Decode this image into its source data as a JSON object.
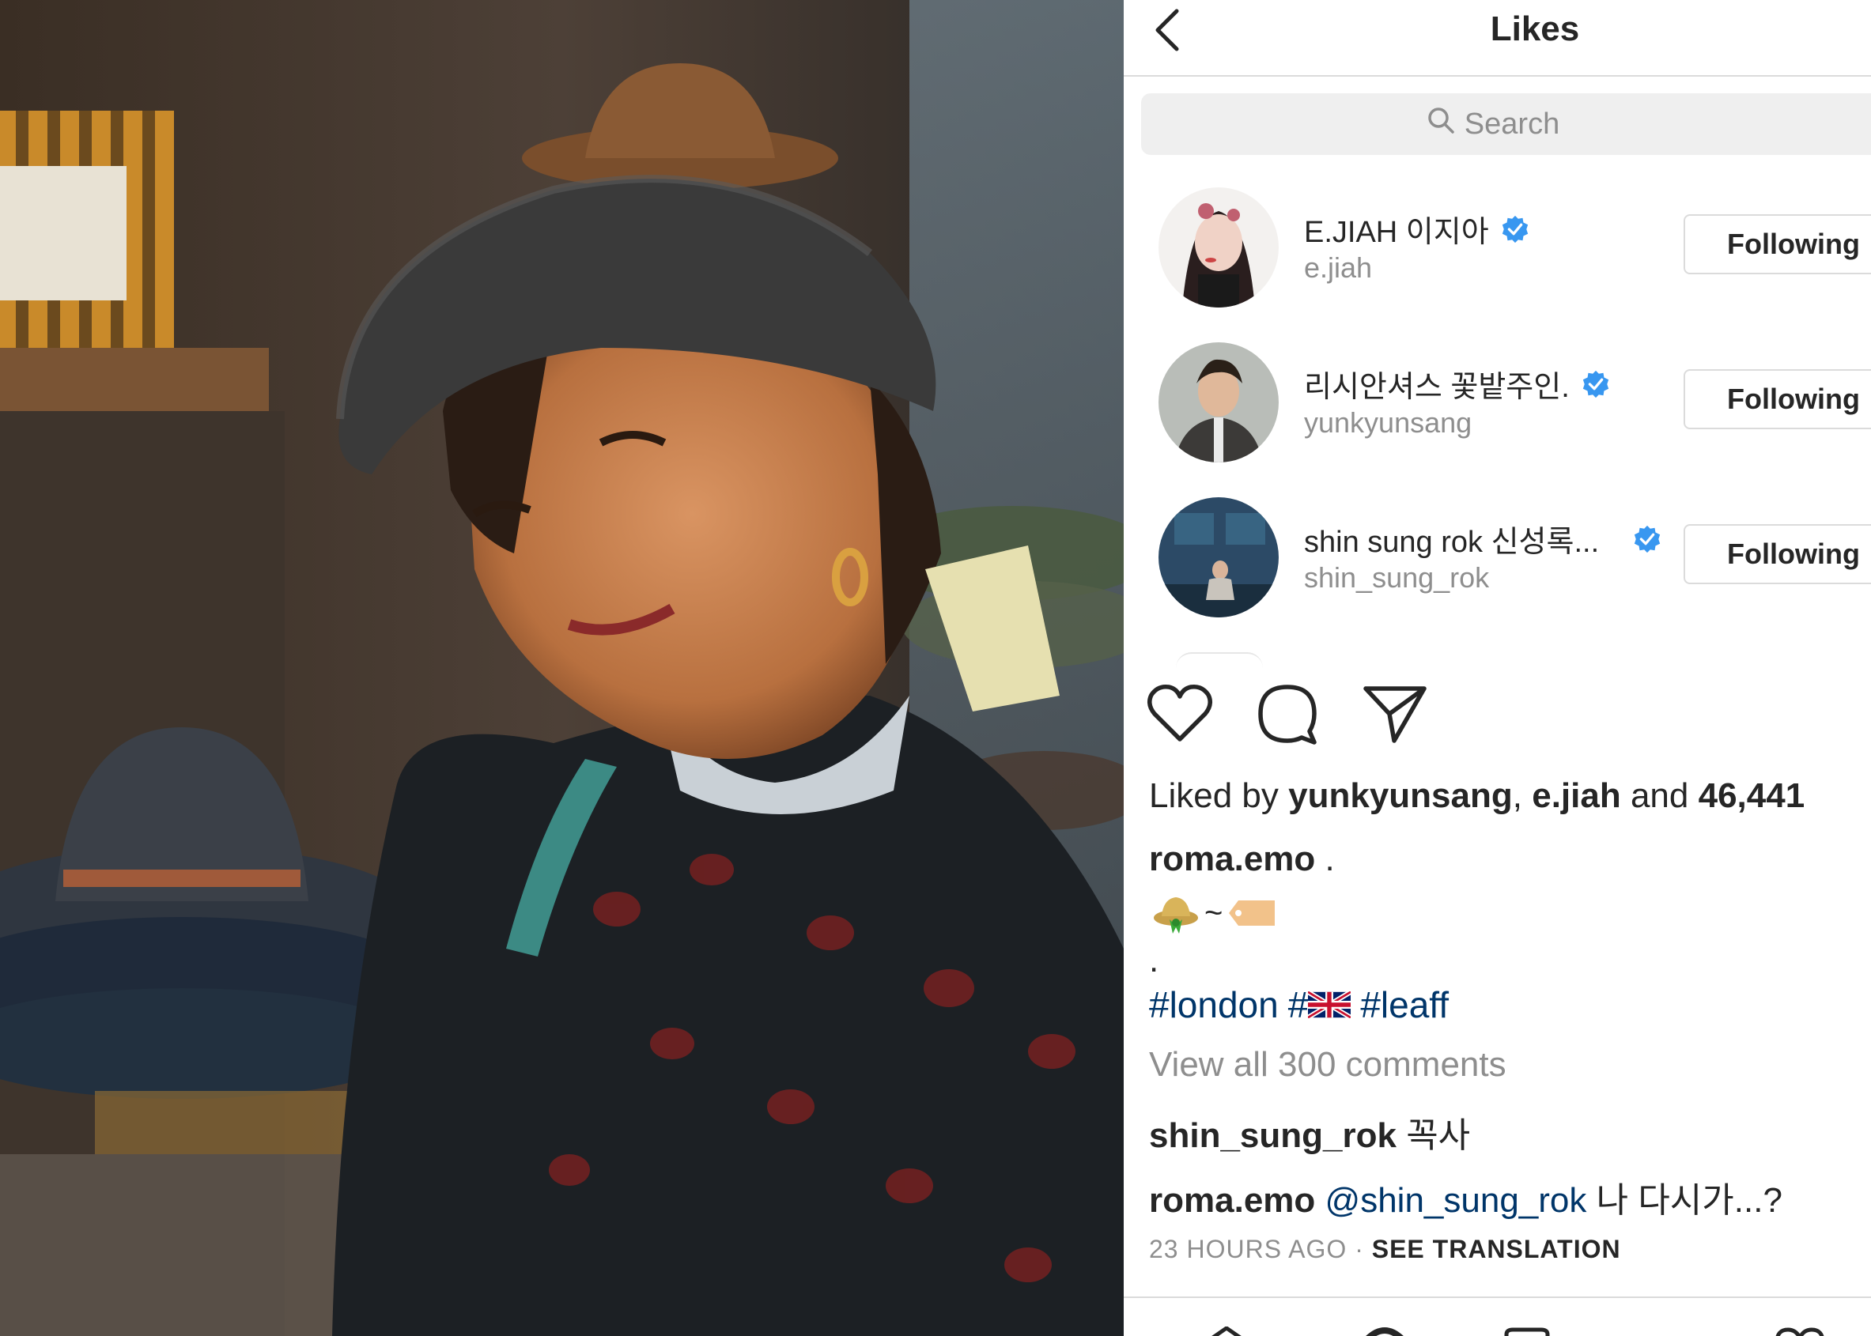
{
  "header": {
    "title": "Likes",
    "back_icon": "chevron-left-icon"
  },
  "search": {
    "placeholder": "Search",
    "icon": "search-icon"
  },
  "likers": [
    {
      "name": "E.JIAH 이지아",
      "handle": "e.jiah",
      "verified": true,
      "button": "Following"
    },
    {
      "name": "리시안셔스 꽃밭주인.",
      "handle": "yunkyunsang",
      "verified": true,
      "button": "Following"
    },
    {
      "name": "shin sung rok 신성록...",
      "handle": "shin_sung_rok",
      "verified": true,
      "button": "Following"
    }
  ],
  "post": {
    "actions": [
      "heart-icon",
      "comment-icon",
      "share-icon"
    ],
    "liked_by_prefix": "Liked by",
    "liked_by_user1": "yunkyunsang",
    "liked_by_sep": ",",
    "liked_by_user2": "e.jiah",
    "liked_by_and": "and",
    "liked_by_count": "46,441",
    "caption_user": "roma.emo",
    "caption_text": ".",
    "emoji_sep": "~",
    "dot": ".",
    "hashtag1": "#london",
    "hashtag2": "#",
    "hashtag3": "#leaff",
    "view_all": "View all 300 comments",
    "comments": [
      {
        "user": "shin_sung_rok",
        "text": "꼭사"
      },
      {
        "user": "roma.emo",
        "mention": "@shin_sung_rok",
        "text": "나 다시가...?"
      }
    ],
    "time": "23 HOURS AGO",
    "time_sep": "·",
    "see_translation": "SEE TRANSLATION"
  },
  "colors": {
    "link": "#003569",
    "verified": "#3897f0",
    "muted": "#8e8e8e",
    "border": "#dbdbdb"
  }
}
